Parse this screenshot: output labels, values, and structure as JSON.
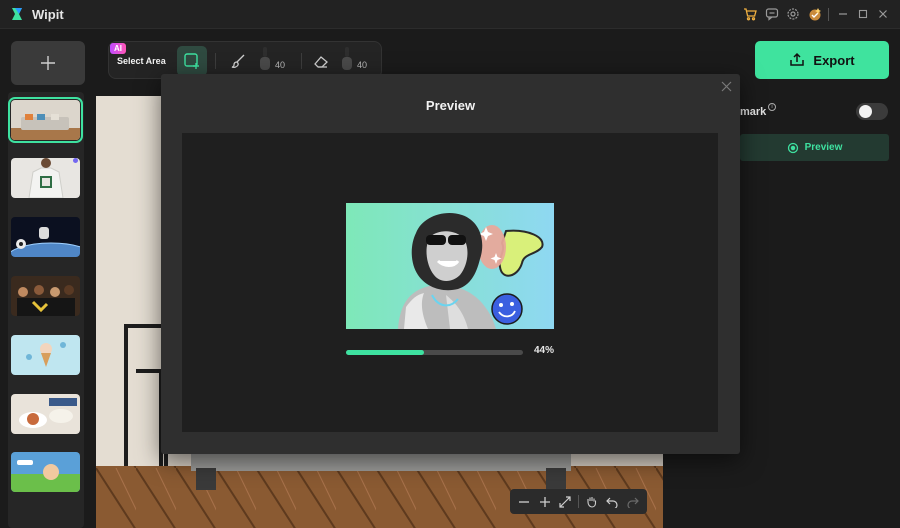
{
  "app": {
    "title": "Wipit"
  },
  "titlebar": {
    "icons": [
      "cart-icon",
      "feedback-icon",
      "settings-icon",
      "premium-icon"
    ],
    "window_controls": [
      "minimize-icon",
      "maximize-icon",
      "close-icon"
    ]
  },
  "sidebar": {
    "add_icon": "plus-icon",
    "thumbnails": [
      "living-room",
      "tshirt-person",
      "astronaut-space",
      "graduates",
      "ice-cream",
      "food-table",
      "wipit-banner"
    ],
    "selected_index": 0
  },
  "toolbar": {
    "ai_badge": "AI",
    "select_area_label": "Select Area",
    "brush_size": "40",
    "eraser_size": "40"
  },
  "export": {
    "label": "Export"
  },
  "right_panel": {
    "watermark_label": "mark",
    "info_icon": "i",
    "watermark_enabled": false,
    "preview_label": "Preview"
  },
  "modal": {
    "title": "Preview",
    "progress_label": "44%",
    "progress_value": 0.44
  },
  "colors": {
    "accent": "#3ee1a0",
    "export": "#3fe39e",
    "bg": "#1b1b1b"
  }
}
